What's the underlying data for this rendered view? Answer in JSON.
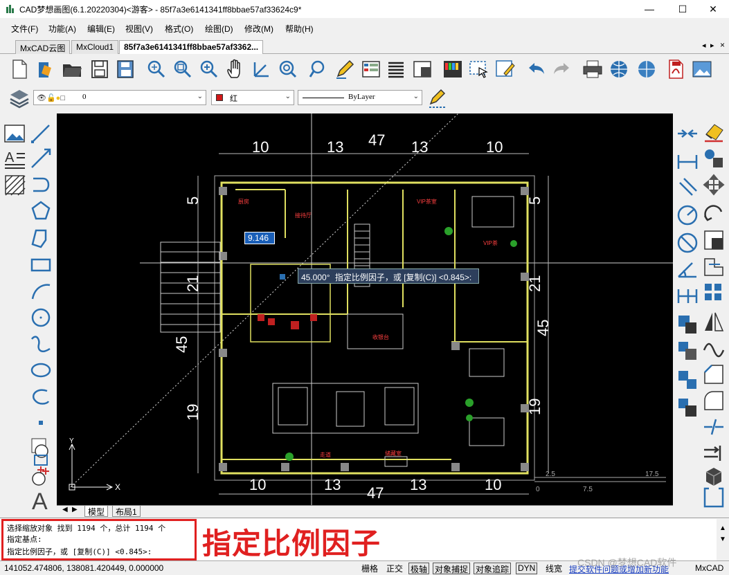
{
  "window": {
    "title": "CAD梦想画图(6.1.20220304)<游客> - 85f7a3e6141341ff8bbae57af33624c9*",
    "minimize_glyph": "—",
    "maximize_glyph": "☐",
    "close_glyph": "✕"
  },
  "menu": [
    "文件(F)",
    "功能(A)",
    "编辑(E)",
    "视图(V)",
    "格式(O)",
    "绘图(D)",
    "修改(M)",
    "帮助(H)"
  ],
  "tabs": [
    {
      "label": "MxCAD云图"
    },
    {
      "label": "MxCloud1"
    },
    {
      "label": "85f7a3e6141341ff8bbae57af3362..."
    }
  ],
  "tab_nav": {
    "prev": "◂",
    "next": "▸",
    "close": "×"
  },
  "properties_bar": {
    "layer_value": "0",
    "color_value": "红",
    "color_hex": "#d01818",
    "linetype_value": "ByLayer"
  },
  "canvas": {
    "dims_top": [
      "10",
      "13",
      "47",
      "13",
      "10"
    ],
    "dims_bottom": [
      "10",
      "13",
      "47",
      "13",
      "10"
    ],
    "dims_left": [
      "5",
      "21",
      "45",
      "19"
    ],
    "dims_right": [
      "5",
      "21",
      "45",
      "19"
    ],
    "input_value": "9.146",
    "angle_tooltip": "45.000°",
    "prompt_tooltip": "指定比例因子，或 [复制(C)] <0.845>:",
    "scale_labels": [
      "2.5",
      "17.5",
      "0",
      "7.5"
    ],
    "ucs_x": "X",
    "ucs_y": "Y",
    "room_labels": [
      "VIP茶室",
      "VIP茶",
      "接待厅",
      "收银台",
      "走道",
      "储藏室",
      "厨房"
    ]
  },
  "layout_tabs": {
    "model": "模型",
    "layout1": "布局1"
  },
  "command": {
    "lines": [
      "选择缩放对象  找到 1194 个，总计 1194 个",
      "指定基点:",
      "指定比例因子，或 [复制(C)] <0.845>:"
    ],
    "annotation": "指定比例因子"
  },
  "status": {
    "coords": "141052.474806,  138081.420449,  0.000000",
    "buttons": [
      {
        "label": "栅格",
        "on": false
      },
      {
        "label": "正交",
        "on": false
      },
      {
        "label": "极轴",
        "on": true
      },
      {
        "label": "对象捕捉",
        "on": true
      },
      {
        "label": "对象追踪",
        "on": true
      },
      {
        "label": "DYN",
        "on": true
      },
      {
        "label": "线宽",
        "on": false
      }
    ],
    "link": "提交软件问题或增加新功能",
    "brand": "MxCAD",
    "watermark": "CSDN @梦想CAD软件"
  }
}
